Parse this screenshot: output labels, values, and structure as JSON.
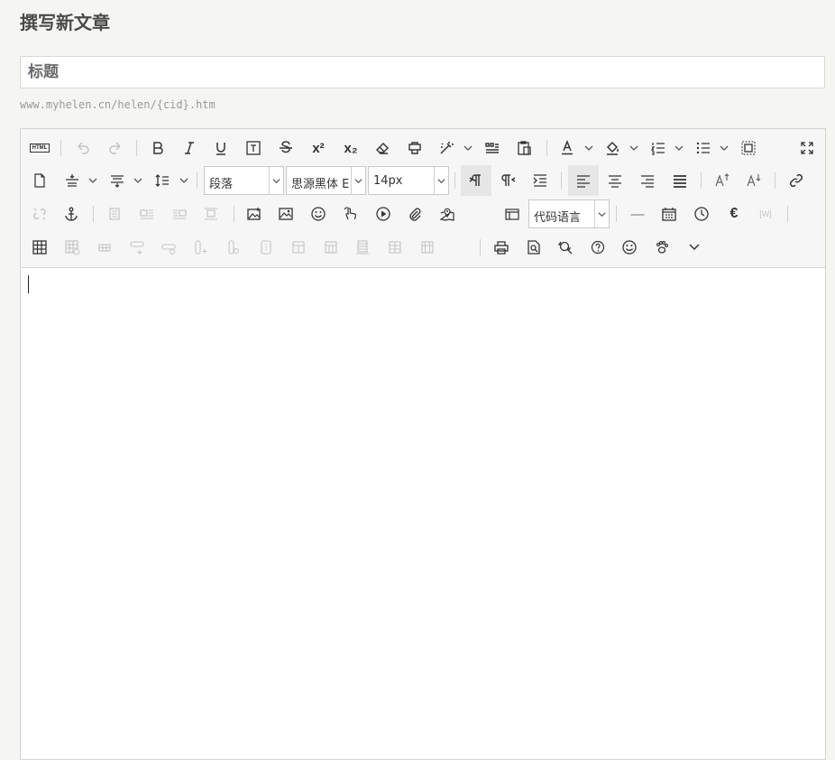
{
  "page": {
    "title": "撰写新文章"
  },
  "form": {
    "title_placeholder": "标题",
    "title_value": "",
    "slug_text": "www.myhelen.cn/helen/{cid}.htm"
  },
  "toolbar": {
    "paragraph_select": "段落",
    "font_family_select": "思源黑体 E",
    "font_size_select": "14px",
    "code_language_select": "代码语言",
    "html_label": "HTML",
    "superscript_label": "x²",
    "subscript_label": "x₂",
    "euro_label": "€",
    "wordcount_label": "[W]",
    "hr_label": "—"
  },
  "editor": {
    "body_text": ""
  }
}
